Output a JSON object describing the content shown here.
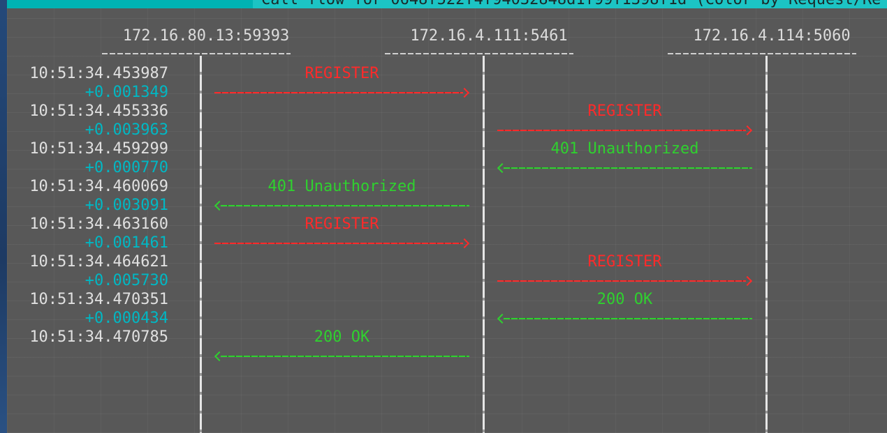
{
  "window": {
    "title": "Call flow for 0648f522f4f94032848d1f99f1398f1d (Color by Request/Re"
  },
  "endpoints": [
    "172.16.80.13:59393",
    "172.16.4.111:5461",
    "172.16.4.114:5060"
  ],
  "messages": [
    {
      "time": "10:51:34.453987",
      "delta": "+0.001349",
      "label": "REGISTER",
      "from": 0,
      "to": 1,
      "color": "#ff2a2a"
    },
    {
      "time": "10:51:34.455336",
      "delta": "+0.003963",
      "label": "REGISTER",
      "from": 1,
      "to": 2,
      "color": "#ff2a2a"
    },
    {
      "time": "10:51:34.459299",
      "delta": "+0.000770",
      "label": "401 Unauthorized",
      "from": 2,
      "to": 1,
      "color": "#2fd12f"
    },
    {
      "time": "10:51:34.460069",
      "delta": "+0.003091",
      "label": "401 Unauthorized",
      "from": 1,
      "to": 0,
      "color": "#2fd12f"
    },
    {
      "time": "10:51:34.463160",
      "delta": "+0.001461",
      "label": "REGISTER",
      "from": 0,
      "to": 1,
      "color": "#ff2a2a"
    },
    {
      "time": "10:51:34.464621",
      "delta": "+0.005730",
      "label": "REGISTER",
      "from": 1,
      "to": 2,
      "color": "#ff2a2a"
    },
    {
      "time": "10:51:34.470351",
      "delta": "+0.000434",
      "label": "200 OK",
      "from": 2,
      "to": 1,
      "color": "#2fd12f"
    },
    {
      "time": "10:51:34.470785",
      "delta": "",
      "label": "200 OK",
      "from": 1,
      "to": 0,
      "color": "#2fd12f"
    }
  ]
}
